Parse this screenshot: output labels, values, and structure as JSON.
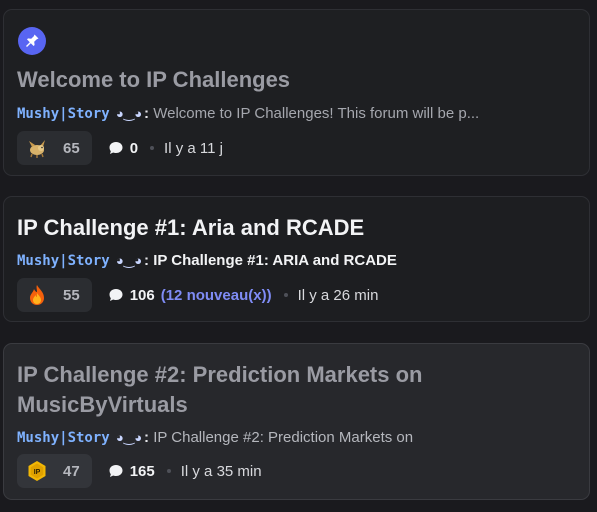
{
  "posts": [
    {
      "pinned": true,
      "title": "Welcome to IP Challenges",
      "author": "Mushy|Story",
      "author_deco": "◕‿◕",
      "colon": ":",
      "preview": "Welcome to IP Challenges! This forum will be p...",
      "reaction_icon": "dragon-icon",
      "reaction_count": "65",
      "message_count": "0",
      "new_messages": "",
      "time": "Il y a 11 j"
    },
    {
      "pinned": false,
      "title": "IP Challenge #1: Aria and RCADE",
      "author": "Mushy|Story",
      "author_deco": "◕‿◕",
      "colon": ":",
      "preview": "IP Challenge #1: ARIA and RCADE",
      "reaction_icon": "fire-icon",
      "reaction_count": "55",
      "message_count": "106",
      "new_messages": "(12 nouveau(x))",
      "time": "Il y a 26 min"
    },
    {
      "pinned": false,
      "title": "IP Challenge #2: Prediction Markets on MusicByVirtuals",
      "author": "Mushy|Story",
      "author_deco": "◕‿◕",
      "colon": ":",
      "preview": "IP Challenge #2: Prediction Markets on",
      "reaction_icon": "ip-coin-icon",
      "reaction_count": "47",
      "message_count": "165",
      "new_messages": "",
      "time": "Il y a 35 min"
    }
  ],
  "colors": {
    "background": "#1a1a1e",
    "accent": "#5865f2",
    "new_messages": "#7f8cf5",
    "author": "#7fb2ff"
  }
}
